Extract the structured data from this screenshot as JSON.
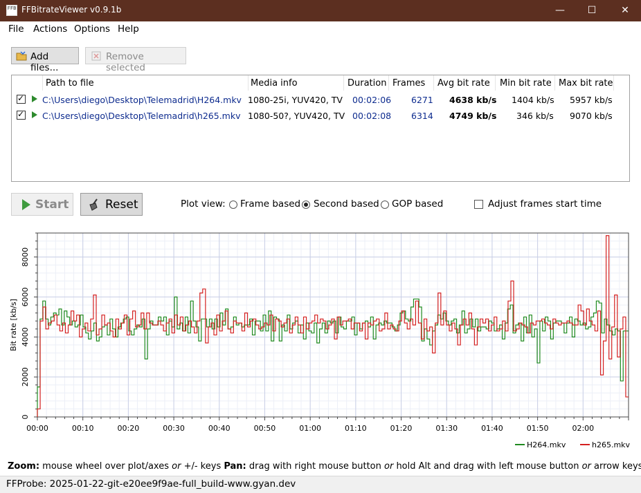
{
  "window": {
    "title": "FFBitrateViewer v0.9.1b",
    "icon_text": "FFB",
    "minimize": "—",
    "maximize": "☐",
    "close": "✕"
  },
  "menu": [
    "File",
    "Actions",
    "Options",
    "Help"
  ],
  "toolbar": {
    "add_files": "Add files...",
    "remove_selected": "Remove selected"
  },
  "table": {
    "headers": [
      "Path to file",
      "Media info",
      "Duration",
      "Frames",
      "Avg bit rate",
      "Min bit rate",
      "Max bit rate"
    ],
    "rows": [
      {
        "path": "C:\\Users\\diego\\Desktop\\Telemadrid\\H264.mkv",
        "media": "1080-25i, YUV420, TV",
        "duration": "00:02:06",
        "frames": "6271",
        "avg": "4638 kb/s",
        "min": "1404 kb/s",
        "max": "5957 kb/s"
      },
      {
        "path": "C:\\Users\\diego\\Desktop\\Telemadrid\\h265.mkv",
        "media": "1080-50?, YUV420, TV",
        "duration": "00:02:08",
        "frames": "6314",
        "avg": "4749 kb/s",
        "min": "346 kb/s",
        "max": "9070 kb/s"
      }
    ]
  },
  "controls": {
    "start": "Start",
    "reset": "Reset",
    "plot_view_label": "Plot view:",
    "plot_view_options": [
      "Frame based",
      "Second based",
      "GOP based"
    ],
    "plot_view_selected": "Second based",
    "adjust_label": "Adjust frames start time",
    "adjust_checked": false
  },
  "chart_data": {
    "type": "line",
    "step": true,
    "ylabel": "Bit rate [kb/s]",
    "ylim": [
      0,
      9200
    ],
    "xlim": [
      0,
      130
    ],
    "yticks": [
      0,
      2000,
      4000,
      6000,
      8000
    ],
    "xticks": [
      "00:00",
      "00:10",
      "00:20",
      "00:30",
      "00:40",
      "00:50",
      "01:00",
      "01:10",
      "01:20",
      "01:30",
      "01:40",
      "01:50",
      "02:00"
    ],
    "grid": true,
    "legend_position": "bottom-right",
    "series": [
      {
        "name": "H264.mkv",
        "color": "#1f8a1f",
        "values": [
          1500,
          4900,
          5800,
          4900,
          4600,
          5000,
          5200,
          5100,
          5400,
          4600,
          5300,
          5000,
          4600,
          4800,
          4500,
          4600,
          5100,
          4500,
          4200,
          3900,
          4300,
          4700,
          3800,
          4000,
          4500,
          4600,
          4100,
          4900,
          4400,
          4000,
          4500,
          4700,
          4900,
          5000,
          4300,
          4100,
          4400,
          4600,
          4500,
          4900,
          2900,
          4400,
          4800,
          4600,
          4600,
          5000,
          4800,
          5000,
          4100,
          4800,
          4500,
          6000,
          4400,
          4700,
          4300,
          5000,
          4200,
          5800,
          4800,
          4500,
          3800,
          4900,
          4900,
          4500,
          4900,
          4400,
          4900,
          4500,
          5200,
          4600,
          5400,
          4400,
          4500,
          5000,
          4600,
          4700,
          4500,
          4600,
          4600,
          4900,
          4100,
          4800,
          4800,
          4300,
          5100,
          4300,
          5300,
          3800,
          5000,
          4900,
          3800,
          4600,
          4300,
          5100,
          4400,
          4700,
          4800,
          4200,
          4600,
          3900,
          4700,
          4300,
          4200,
          4700,
          3700,
          4400,
          4700,
          4200,
          4800,
          4700,
          4800,
          4200,
          5000,
          4500,
          4400,
          4800,
          4800,
          5000,
          4100,
          4700,
          4400,
          4700,
          4800,
          4500,
          5000,
          3900,
          4600,
          4700,
          4600,
          4800,
          4700,
          4700,
          4500,
          4300,
          4600,
          5200,
          5300,
          4900,
          4800,
          5500,
          5900,
          5900,
          5500,
          3800,
          4400,
          3900,
          3600,
          4300,
          4600,
          5100,
          4900,
          5200,
          4800,
          4600,
          4800,
          4900,
          4200,
          4600,
          5300,
          4200,
          4400,
          4900,
          4500,
          4900,
          4300,
          4500,
          4500,
          4400,
          4800,
          4700,
          4300,
          4400,
          4600,
          3900,
          4700,
          5400,
          5600,
          4200,
          4600,
          4700,
          3800,
          5000,
          4200,
          5100,
          4000,
          4400,
          2700,
          4800,
          4300,
          5000,
          4800,
          3900,
          4700,
          4800,
          4800,
          4700,
          4200,
          4700,
          5000,
          4000,
          4900,
          4800,
          4600,
          4700,
          4400,
          4500,
          5000,
          5200,
          5800,
          5700,
          4200,
          4900,
          4600,
          4300,
          4100,
          4400,
          4300,
          1800,
          4300,
          4300
        ]
      },
      {
        "name": "h265.mkv",
        "color": "#d42020",
        "values": [
          400,
          4800,
          5500,
          4400,
          4700,
          4800,
          5100,
          4600,
          4300,
          4700,
          4200,
          4600,
          5300,
          4800,
          5100,
          4000,
          4400,
          4700,
          4300,
          4900,
          6100,
          4100,
          4400,
          5100,
          4600,
          4700,
          4300,
          4000,
          4900,
          4400,
          4700,
          5100,
          4100,
          4900,
          5300,
          4500,
          4600,
          5200,
          4400,
          5200,
          4700,
          4600,
          4600,
          4800,
          4600,
          4300,
          4700,
          4900,
          4200,
          5100,
          4600,
          5000,
          4300,
          4600,
          4800,
          4500,
          4200,
          4800,
          6200,
          6400,
          3700,
          4500,
          4700,
          4100,
          5100,
          4300,
          4800,
          5300,
          4400,
          4200,
          4800,
          4700,
          4700,
          4300,
          5200,
          4500,
          4800,
          4900,
          4600,
          4400,
          4500,
          4700,
          4600,
          5100,
          4300,
          4900,
          4800,
          4500,
          4700,
          4900,
          4200,
          4600,
          5000,
          4600,
          4200,
          5000,
          4400,
          4700,
          4800,
          5100,
          4700,
          4900,
          4800,
          4400,
          4600,
          4900,
          3900,
          5000,
          4600,
          4800,
          4800,
          4900,
          4400,
          4700,
          4700,
          4300,
          4700,
          3900,
          4700,
          4600,
          4800,
          4900,
          4300,
          4400,
          5200,
          4400,
          4600,
          4400,
          4300,
          4800,
          5300,
          4700,
          4400,
          4900,
          4600,
          5800,
          4700,
          3900,
          4900,
          4300,
          4500,
          3200,
          4700,
          6200,
          4600,
          5300,
          4600,
          4300,
          4700,
          4400,
          3600,
          4600,
          4900,
          4600,
          5200,
          4400,
          3600,
          4500,
          4900,
          4700,
          4900,
          4300,
          4600,
          5000,
          4300,
          4400,
          4800,
          4300,
          5800,
          6800,
          4300,
          4400,
          4700,
          4600,
          4500,
          4200,
          4700,
          4600,
          4800,
          4800,
          4900,
          4700,
          4600,
          4400,
          4900,
          4700,
          4600,
          4700,
          4700,
          4800,
          4700,
          4600,
          4600,
          5600,
          5300,
          4600,
          5400,
          4800,
          4600,
          4300,
          5300,
          2100,
          3800,
          9070,
          2900,
          4500,
          6100,
          3000,
          4400,
          5000,
          1000
        ]
      }
    ]
  },
  "hint": {
    "zoom_label": "Zoom:",
    "zoom_text": " mouse wheel over plot/axes ",
    "or1": "or",
    "zoom_text2": " +/- keys  ",
    "pan_label": "Pan:",
    "pan_text": " drag with right mouse button ",
    "or2": "or",
    "pan_text2": " hold Alt and drag with left mouse button ",
    "or3": "or",
    "pan_text3": " arrow keys."
  },
  "status": "FFProbe: 2025-01-22-git-e20ee9f9ae-full_build-www.gyan.dev"
}
